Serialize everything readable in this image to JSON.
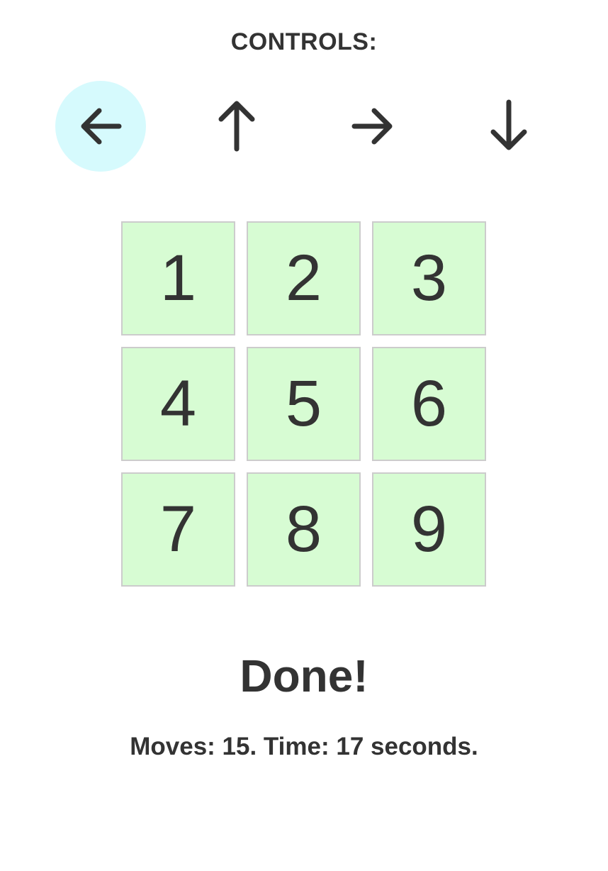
{
  "controls": {
    "title": "CONTROLS:",
    "buttons": [
      {
        "icon": "arrow-left-icon",
        "active": true
      },
      {
        "icon": "arrow-up-icon",
        "active": false
      },
      {
        "icon": "arrow-right-icon",
        "active": false
      },
      {
        "icon": "arrow-down-icon",
        "active": false
      }
    ],
    "active_color": "#d6fafd"
  },
  "board": {
    "tiles": [
      "1",
      "2",
      "3",
      "4",
      "5",
      "6",
      "7",
      "8",
      "9"
    ],
    "tile_color": "#d7fcd3",
    "tile_border_color": "#cccccc"
  },
  "status": {
    "message": "Done!",
    "stats": "Moves: 15. Time: 17 seconds."
  }
}
